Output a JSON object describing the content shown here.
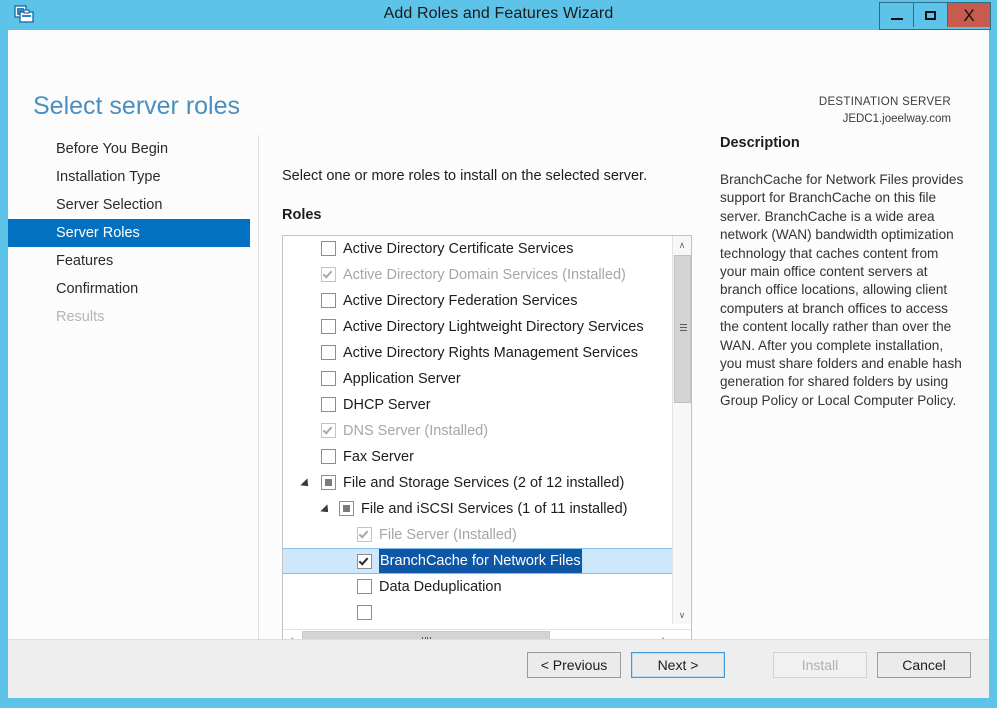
{
  "window": {
    "title": "Add Roles and Features Wizard",
    "icon": "server-manager-icon",
    "minimize_label": "–",
    "maximize_label": "□",
    "close_label": "X",
    "accent_color": "#5dc3e8",
    "close_color": "#c75b4e"
  },
  "header": {
    "page_title": "Select server roles",
    "destination_label": "DESTINATION SERVER",
    "destination_server": "JEDC1.joeelway.com",
    "title_color": "#4a8fbf"
  },
  "nav": {
    "selected_color": "#0271c1",
    "items": [
      {
        "label": "Before You Begin",
        "state": "normal"
      },
      {
        "label": "Installation Type",
        "state": "normal"
      },
      {
        "label": "Server Selection",
        "state": "normal"
      },
      {
        "label": "Server Roles",
        "state": "selected"
      },
      {
        "label": "Features",
        "state": "normal"
      },
      {
        "label": "Confirmation",
        "state": "normal"
      },
      {
        "label": "Results",
        "state": "disabled"
      }
    ]
  },
  "main": {
    "intro": "Select one or more roles to install on the selected server.",
    "roles_label": "Roles",
    "roles": [
      {
        "label": "Active Directory Certificate Services",
        "indent": 0,
        "checkbox": "unchecked",
        "twisty": false,
        "installed": false,
        "selected": false
      },
      {
        "label": "Active Directory Domain Services (Installed)",
        "indent": 0,
        "checkbox": "checked",
        "twisty": false,
        "installed": true,
        "selected": false
      },
      {
        "label": "Active Directory Federation Services",
        "indent": 0,
        "checkbox": "unchecked",
        "twisty": false,
        "installed": false,
        "selected": false
      },
      {
        "label": "Active Directory Lightweight Directory Services",
        "indent": 0,
        "checkbox": "unchecked",
        "twisty": false,
        "installed": false,
        "selected": false
      },
      {
        "label": "Active Directory Rights Management Services",
        "indent": 0,
        "checkbox": "unchecked",
        "twisty": false,
        "installed": false,
        "selected": false
      },
      {
        "label": "Application Server",
        "indent": 0,
        "checkbox": "unchecked",
        "twisty": false,
        "installed": false,
        "selected": false
      },
      {
        "label": "DHCP Server",
        "indent": 0,
        "checkbox": "unchecked",
        "twisty": false,
        "installed": false,
        "selected": false
      },
      {
        "label": "DNS Server (Installed)",
        "indent": 0,
        "checkbox": "checked",
        "twisty": false,
        "installed": true,
        "selected": false
      },
      {
        "label": "Fax Server",
        "indent": 0,
        "checkbox": "unchecked",
        "twisty": false,
        "installed": false,
        "selected": false
      },
      {
        "label": "File and Storage Services (2 of 12 installed)",
        "indent": 0,
        "checkbox": "partial",
        "twisty": true,
        "installed": false,
        "selected": false
      },
      {
        "label": "File and iSCSI Services (1 of 11 installed)",
        "indent": 1,
        "checkbox": "partial",
        "twisty": true,
        "installed": false,
        "selected": false
      },
      {
        "label": "File Server (Installed)",
        "indent": 2,
        "checkbox": "checked",
        "twisty": false,
        "installed": true,
        "selected": false
      },
      {
        "label": "BranchCache for Network Files",
        "indent": 2,
        "checkbox": "checked",
        "twisty": false,
        "installed": false,
        "selected": true
      },
      {
        "label": "Data Deduplication",
        "indent": 2,
        "checkbox": "unchecked",
        "twisty": false,
        "installed": false,
        "selected": false
      }
    ],
    "selection_row_background": "#cde8fb",
    "selection_text_background": "#0d57a6",
    "scrollbar": {
      "up_arrow": "∧",
      "down_arrow": "∨",
      "left_arrow": "‹",
      "right_arrow": "›"
    }
  },
  "description": {
    "title": "Description",
    "body": "BranchCache for Network Files provides support for BranchCache on this file server. BranchCache is a wide area network (WAN) bandwidth optimization technology that caches content from your main office content servers at branch office locations, allowing client computers at branch offices to access the content locally rather than over the WAN. After you complete installation, you must share folders and enable hash generation for shared folders by using Group Policy or Local Computer Policy."
  },
  "footer": {
    "previous_label": "< Previous",
    "next_label": "Next >",
    "install_label": "Install",
    "cancel_label": "Cancel",
    "install_disabled": true,
    "next_focused": true
  }
}
